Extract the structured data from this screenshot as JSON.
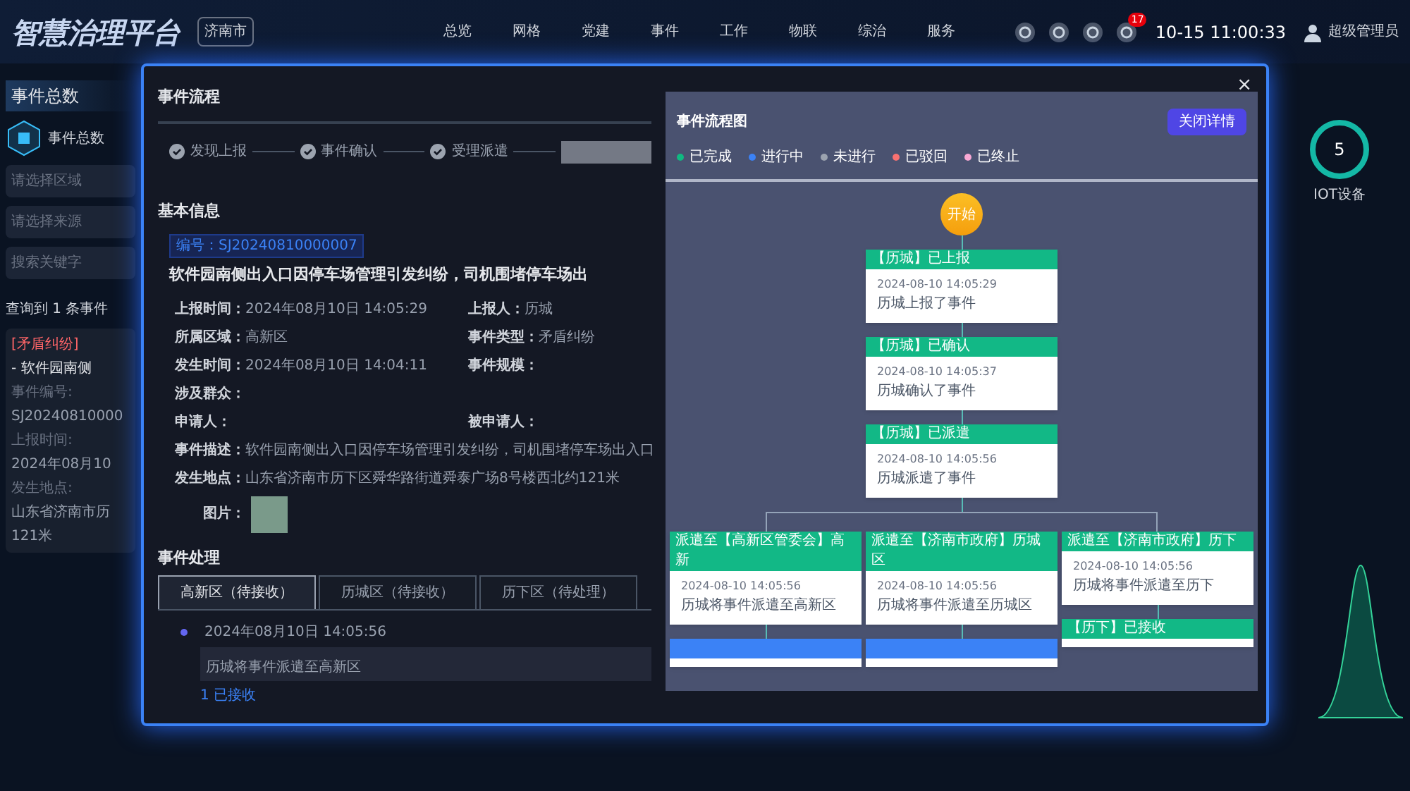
{
  "header": {
    "title": "智慧治理平台",
    "city": "济南市",
    "nav": [
      "总览",
      "网格",
      "党建",
      "事件",
      "工作",
      "物联",
      "综治",
      "服务"
    ],
    "badge": "17",
    "time": "10-15 11:00:33",
    "user": "超级管理员"
  },
  "left_panel": {
    "title": "事件总数",
    "total_label": "事件总数",
    "filters": [
      "请选择区域",
      "请选择来源"
    ],
    "search": {
      "placeholder": "搜索关键字"
    },
    "result": "查询到 1 条事件",
    "card": {
      "tag": "[矛盾纠纷]",
      "title": "- 软件园南侧",
      "fields": [
        {
          "label": "事件编号:",
          "value": "SJ20240810000"
        },
        {
          "label": "上报时间:",
          "value": "2024年08月10"
        },
        {
          "label": "发生地点:",
          "value": "山东省济南市历"
        }
      ],
      "extra": "121米"
    }
  },
  "right_panel": {
    "gauge_value": "5",
    "gauge_label": "IOT设备"
  },
  "modal": {
    "close": "×",
    "process": {
      "title": "事件流程",
      "steps": [
        {
          "label": "发现上报",
          "done": true
        },
        {
          "label": "事件确认",
          "done": true
        },
        {
          "label": "受理派遣",
          "done": true
        }
      ]
    },
    "basic": {
      "title": "基本信息",
      "number": "编号：SJ20240810000007",
      "headline": "软件园南侧出入口因停车场管理引发纠纷，司机围堵停车场出",
      "rows": [
        [
          {
            "label": "上报时间：",
            "value": "2024年08月10日 14:05:29"
          },
          {
            "label": "上报人：",
            "value": "历城"
          }
        ],
        [
          {
            "label": "所属区域：",
            "value": "高新区"
          },
          {
            "label": "事件类型：",
            "value": "矛盾纠纷"
          }
        ],
        [
          {
            "label": "发生时间：",
            "value": "2024年08月10日 14:04:11"
          },
          {
            "label": "事件规模："
          }
        ],
        [
          {
            "label": "涉及群众："
          }
        ],
        [
          {
            "label": "申请人："
          },
          {
            "label": "被申请人："
          }
        ]
      ],
      "wide_fields": [
        {
          "label": "事件描述：",
          "value": "软件园南侧出入口因停车场管理引发纠纷，司机围堵停车场出入口"
        },
        {
          "label": "发生地点：",
          "value": "山东省济南市历下区舜华路街道舜泰广场8号楼西北约121米"
        }
      ],
      "photo_label": "图片："
    },
    "handling": {
      "title": "事件处理",
      "tabs": [
        {
          "label": "高新区（待接收）",
          "selected": true
        },
        {
          "label": "历城区（待接收）",
          "selected": false
        },
        {
          "label": "历下区（待处理）",
          "selected": false
        }
      ],
      "timeline": [
        {
          "time": "2024年08月10日 14:05:56",
          "text": "历城将事件派遣至高新区"
        }
      ],
      "next": "1 已接收"
    },
    "flow": {
      "title": "事件流程图",
      "close_button": "关闭详情",
      "legend": [
        {
          "label": "已完成",
          "color": "#10b981"
        },
        {
          "label": "进行中",
          "color": "#3b82f6"
        },
        {
          "label": "未进行",
          "color": "#9ca3af"
        },
        {
          "label": "已驳回",
          "color": "#f87171"
        },
        {
          "label": "已终止",
          "color": "#f9a8d4"
        }
      ],
      "start": "开始",
      "chain": [
        {
          "in_progress": false,
          "title": "【历城】已上报",
          "time": "2024-08-10 14:05:29",
          "text": "历城上报了事件"
        },
        {
          "in_progress": false,
          "title": "【历城】已确认",
          "time": "2024-08-10 14:05:37",
          "text": "历城确认了事件"
        },
        {
          "in_progress": false,
          "title": "【历城】已派遣",
          "time": "2024-08-10 14:05:56",
          "text": "历城派遣了事件"
        }
      ],
      "branches": [
        {
          "node": {
            "in_progress": false,
            "title": "派遣至【高新区管委会】高新",
            "time": "2024-08-10 14:05:56",
            "text": "历城将事件派遣至高新区"
          },
          "next": {
            "in_progress": true
          }
        },
        {
          "node": {
            "in_progress": false,
            "title": "派遣至【济南市政府】历城区",
            "time": "2024-08-10 14:05:56",
            "text": "历城将事件派遣至历城区"
          },
          "next": {
            "in_progress": true
          }
        },
        {
          "node": {
            "in_progress": false,
            "title": "派遣至【济南市政府】历下",
            "time": "2024-08-10 14:05:56",
            "text": "历城将事件派遣至历下"
          },
          "next": {
            "in_progress": false,
            "title": "【历下】已接收"
          }
        }
      ]
    }
  }
}
